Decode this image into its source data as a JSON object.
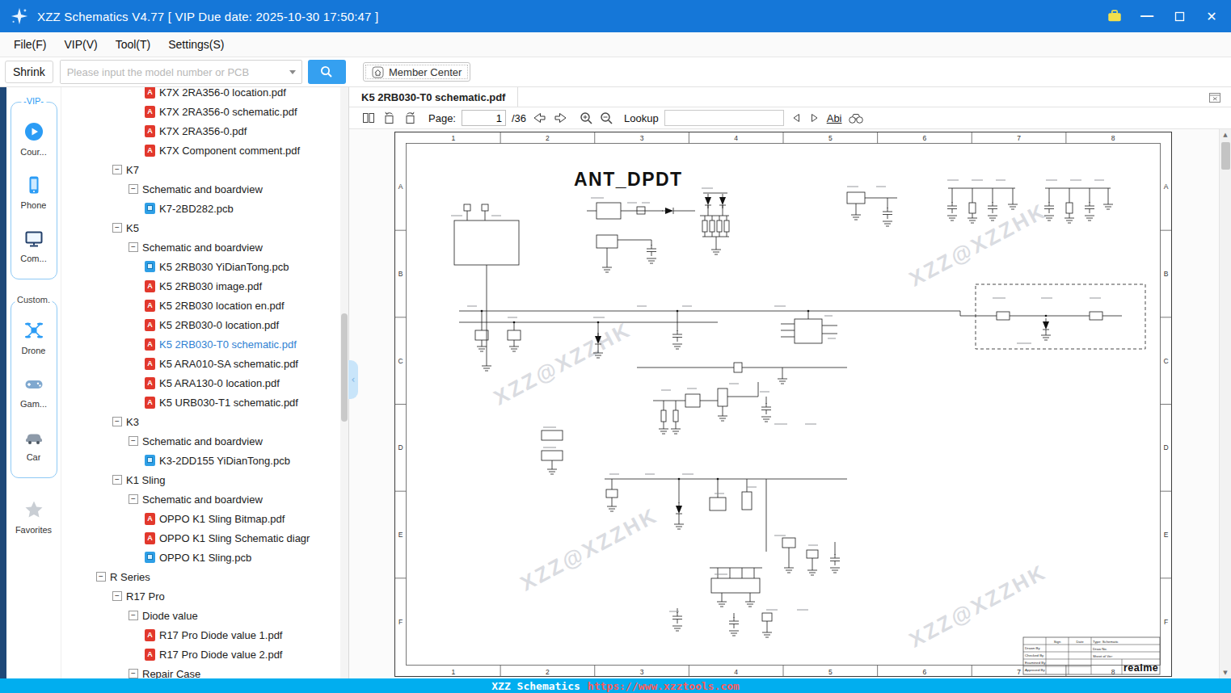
{
  "titlebar": {
    "title": "XZZ Schematics V4.77 [ VIP Due date: 2025-10-30 17:50:47 ]"
  },
  "menubar": {
    "items": [
      "File(F)",
      "VIP(V)",
      "Tool(T)",
      "Settings(S)"
    ]
  },
  "toolbar": {
    "shrink_label": "Shrink",
    "search_placeholder": "Please input the model number or PCB",
    "member_center_label": "Member Center"
  },
  "sidebar": {
    "vip_group_label": "-VIP-",
    "vip_items": [
      {
        "label": "Cour...",
        "icon": "course-play-icon"
      },
      {
        "label": "Phone",
        "icon": "phone-icon"
      },
      {
        "label": "Com...",
        "icon": "computer-icon"
      }
    ],
    "custom_group_label": "Custom.",
    "custom_items": [
      {
        "label": "Drone",
        "icon": "drone-icon"
      },
      {
        "label": "Gam...",
        "icon": "gamepad-icon"
      },
      {
        "label": "Car",
        "icon": "car-icon"
      }
    ],
    "favorites_label": "Favorites"
  },
  "tree": {
    "items": [
      {
        "label": "K7X 2RA356-0 location.pdf",
        "icon": "pdf",
        "level": 4
      },
      {
        "label": "K7X 2RA356-0 schematic.pdf",
        "icon": "pdf",
        "level": 4
      },
      {
        "label": "K7X 2RA356-0.pdf",
        "icon": "pdf",
        "level": 4
      },
      {
        "label": "K7X Component comment.pdf",
        "icon": "pdf",
        "level": 4
      },
      {
        "label": "K7",
        "icon": "collapse",
        "level": 2
      },
      {
        "label": "Schematic and boardview",
        "icon": "collapse",
        "level": 3
      },
      {
        "label": "K7-2BD282.pcb",
        "icon": "pcb",
        "level": 4
      },
      {
        "label": "K5",
        "icon": "collapse",
        "level": 2
      },
      {
        "label": "Schematic and boardview",
        "icon": "collapse",
        "level": 3
      },
      {
        "label": "K5 2RB030 YiDianTong.pcb",
        "icon": "pcb",
        "level": 4
      },
      {
        "label": "K5 2RB030 image.pdf",
        "icon": "pdf",
        "level": 4
      },
      {
        "label": "K5 2RB030 location en.pdf",
        "icon": "pdf",
        "level": 4
      },
      {
        "label": "K5 2RB030-0 location.pdf",
        "icon": "pdf",
        "level": 4
      },
      {
        "label": "K5 2RB030-T0 schematic.pdf",
        "icon": "pdf",
        "level": 4,
        "selected": true
      },
      {
        "label": "K5 ARA010-SA schematic.pdf",
        "icon": "pdf",
        "level": 4
      },
      {
        "label": "K5 ARA130-0 location.pdf",
        "icon": "pdf",
        "level": 4
      },
      {
        "label": "K5 URB030-T1 schematic.pdf",
        "icon": "pdf",
        "level": 4
      },
      {
        "label": "K3",
        "icon": "collapse",
        "level": 2
      },
      {
        "label": "Schematic and boardview",
        "icon": "collapse",
        "level": 3
      },
      {
        "label": "K3-2DD155 YiDianTong.pcb",
        "icon": "pcb",
        "level": 4
      },
      {
        "label": "K1 Sling",
        "icon": "collapse",
        "level": 2
      },
      {
        "label": "Schematic and boardview",
        "icon": "collapse",
        "level": 3
      },
      {
        "label": "OPPO K1 Sling Bitmap.pdf",
        "icon": "pdf",
        "level": 4
      },
      {
        "label": "OPPO K1 Sling Schematic diagr",
        "icon": "pdf",
        "level": 4
      },
      {
        "label": "OPPO K1 Sling.pcb",
        "icon": "pcb",
        "level": 4
      },
      {
        "label": "R Series",
        "icon": "collapse",
        "level": 1
      },
      {
        "label": "R17 Pro",
        "icon": "collapse",
        "level": 2
      },
      {
        "label": "Diode value",
        "icon": "collapse",
        "level": 3
      },
      {
        "label": "R17 Pro Diode value 1.pdf",
        "icon": "pdf",
        "level": 4
      },
      {
        "label": "R17 Pro Diode value 2.pdf",
        "icon": "pdf",
        "level": 4
      },
      {
        "label": "Repair Case",
        "icon": "collapse",
        "level": 3
      }
    ]
  },
  "viewer": {
    "tab_label": "K5 2RB030-T0 schematic.pdf",
    "toolbar": {
      "page_label": "Page:",
      "page_value": "1",
      "page_total_label": "/36",
      "lookup_label": "Lookup",
      "lookup_value": "",
      "abi_label": "Abi"
    }
  },
  "schematic": {
    "title": "ANT_DPDT",
    "watermark": "XZZ@XZZHK",
    "columns": [
      "1",
      "2",
      "3",
      "4",
      "5",
      "6",
      "7",
      "8"
    ],
    "rows": [
      "A",
      "B",
      "C",
      "D",
      "E",
      "F"
    ],
    "title_block": {
      "row_labels": [
        "Drawn By",
        "Checked By",
        "Examined By",
        "Approved By"
      ],
      "col_labels": [
        "Sign",
        "Date"
      ],
      "type_label": "Type:",
      "type_value": "Schematic",
      "draw_no_label": "Draw No.",
      "sheet_label": "Sheet",
      "of_label": "of",
      "ver_label": "Ver:",
      "brand": "realme"
    }
  },
  "statusbar": {
    "app_name": "XZZ Schematics",
    "url": "https://www.xzztools.com"
  },
  "icons": {
    "titlebar": [
      "app-logo",
      "skin-icon",
      "minimize-icon",
      "maximize-icon",
      "close-icon"
    ],
    "toolbar": [
      "combo-arrow-icon",
      "search-icon",
      "home-icon"
    ],
    "pdf_toolbar": [
      "two-page-view-icon",
      "rotate-left-icon",
      "rotate-right-icon",
      "prev-page-icon",
      "next-page-icon",
      "zoom-in-icon",
      "zoom-out-icon",
      "search-prev-icon",
      "search-next-icon",
      "binoculars-icon"
    ],
    "sidebar": [
      "course-play-icon",
      "phone-icon",
      "computer-icon",
      "drone-icon",
      "gamepad-icon",
      "car-icon",
      "star-icon"
    ],
    "tree": [
      "collapse-icon",
      "pdf-file-icon",
      "pcb-file-icon"
    ],
    "misc": [
      "close-document-icon",
      "panel-collapse-icon",
      "scroll-up-icon",
      "scroll-down-icon"
    ]
  }
}
